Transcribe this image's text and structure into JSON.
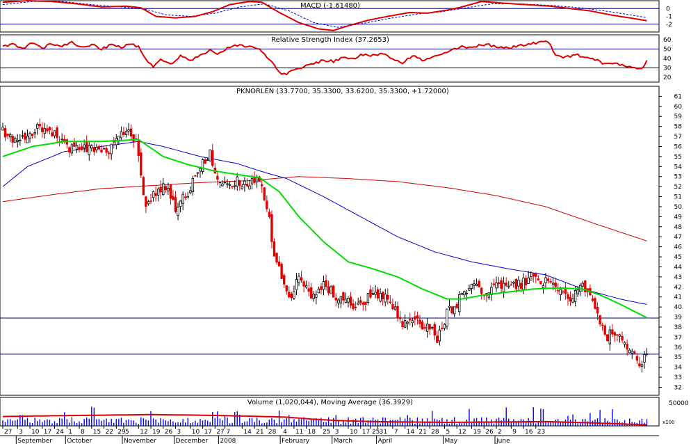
{
  "chart_data": {
    "type": "candlestick",
    "price_panel": {
      "label": "PKNORLEN (33.7700, 35.3300, 33.6200, 35.3300, +1.72000)",
      "ylim": [
        31.2,
        62.0
      ],
      "ticks": [
        32,
        33,
        34,
        35,
        36,
        37,
        38,
        39,
        40,
        41,
        42,
        43,
        44,
        45,
        46,
        47,
        48,
        49,
        50,
        51,
        52,
        53,
        54,
        55,
        56,
        57,
        58,
        59,
        60,
        61
      ],
      "hlines": [
        38.9,
        35.3
      ],
      "close_anchors": [
        [
          0,
          57.5
        ],
        [
          5,
          56.5
        ],
        [
          10,
          57.0
        ],
        [
          15,
          58.0
        ],
        [
          20,
          57.5
        ],
        [
          25,
          56.0
        ],
        [
          30,
          55.8
        ],
        [
          35,
          56.0
        ],
        [
          40,
          55.2
        ],
        [
          45,
          56.0
        ],
        [
          50,
          57.8
        ],
        [
          54,
          56.5
        ],
        [
          58,
          50.0
        ],
        [
          62,
          51.5
        ],
        [
          66,
          52.0
        ],
        [
          70,
          50.0
        ],
        [
          75,
          51.5
        ],
        [
          80,
          54.0
        ],
        [
          84,
          55.5
        ],
        [
          86,
          53.5
        ],
        [
          90,
          52.0
        ],
        [
          95,
          52.6
        ],
        [
          100,
          52.4
        ],
        [
          104,
          52.5
        ],
        [
          108,
          49.0
        ],
        [
          110,
          45.0
        ],
        [
          113,
          43.0
        ],
        [
          117,
          41.0
        ],
        [
          120,
          43.0
        ],
        [
          125,
          41.0
        ],
        [
          130,
          42.5
        ],
        [
          135,
          41.0
        ],
        [
          140,
          40.5
        ],
        [
          145,
          40.0
        ],
        [
          150,
          41.5
        ],
        [
          155,
          41.0
        ],
        [
          158,
          40.0
        ],
        [
          162,
          38.5
        ],
        [
          166,
          39.0
        ],
        [
          170,
          38.2
        ],
        [
          174,
          37.5
        ],
        [
          176,
          36.5
        ],
        [
          180,
          39.5
        ],
        [
          184,
          40.0
        ],
        [
          186,
          41.5
        ],
        [
          190,
          42.0
        ],
        [
          195,
          41.5
        ],
        [
          200,
          42.0
        ],
        [
          205,
          42.0
        ],
        [
          210,
          42.3
        ],
        [
          215,
          43.0
        ],
        [
          220,
          42.5
        ],
        [
          225,
          41.5
        ],
        [
          230,
          41.0
        ],
        [
          235,
          42.0
        ],
        [
          238,
          41.0
        ],
        [
          242,
          38.5
        ],
        [
          244,
          37.0
        ],
        [
          248,
          37.5
        ],
        [
          252,
          36.0
        ],
        [
          256,
          35.0
        ],
        [
          258,
          34.0
        ],
        [
          261,
          35.33
        ]
      ],
      "ma_green": [
        [
          0,
          55.0
        ],
        [
          12,
          56.0
        ],
        [
          25,
          56.5
        ],
        [
          40,
          56.5
        ],
        [
          55,
          56.7
        ],
        [
          65,
          55.0
        ],
        [
          75,
          54.2
        ],
        [
          85,
          53.6
        ],
        [
          95,
          53.2
        ],
        [
          104,
          52.9
        ],
        [
          112,
          51.5
        ],
        [
          120,
          49.0
        ],
        [
          130,
          46.5
        ],
        [
          140,
          44.5
        ],
        [
          150,
          43.8
        ],
        [
          160,
          43.0
        ],
        [
          170,
          41.8
        ],
        [
          180,
          40.8
        ],
        [
          186,
          40.8
        ],
        [
          195,
          41.2
        ],
        [
          205,
          41.5
        ],
        [
          215,
          41.8
        ],
        [
          225,
          41.9
        ],
        [
          235,
          41.8
        ],
        [
          242,
          41.2
        ],
        [
          250,
          40.3
        ],
        [
          258,
          39.3
        ],
        [
          262,
          38.8
        ]
      ],
      "ma_blue": [
        [
          0,
          52.0
        ],
        [
          10,
          54.0
        ],
        [
          25,
          55.5
        ],
        [
          40,
          56.0
        ],
        [
          55,
          56.5
        ],
        [
          65,
          56.0
        ],
        [
          80,
          55.0
        ],
        [
          95,
          54.3
        ],
        [
          105,
          53.5
        ],
        [
          115,
          52.8
        ],
        [
          130,
          51.0
        ],
        [
          145,
          49.0
        ],
        [
          160,
          47.0
        ],
        [
          175,
          45.5
        ],
        [
          190,
          44.5
        ],
        [
          205,
          43.8
        ],
        [
          220,
          43.2
        ],
        [
          235,
          41.8
        ],
        [
          250,
          40.8
        ],
        [
          262,
          40.2
        ]
      ],
      "ma_red": [
        [
          0,
          50.5
        ],
        [
          20,
          51.2
        ],
        [
          40,
          51.8
        ],
        [
          60,
          52.1
        ],
        [
          80,
          52.4
        ],
        [
          100,
          52.6
        ],
        [
          120,
          53.0
        ],
        [
          140,
          52.8
        ],
        [
          160,
          52.5
        ],
        [
          180,
          51.9
        ],
        [
          200,
          51.1
        ],
        [
          220,
          50.0
        ],
        [
          240,
          48.3
        ],
        [
          262,
          46.5
        ]
      ]
    },
    "macd_panel": {
      "label": "MACD (-1.61480)",
      "ylim": [
        -3,
        1
      ],
      "ticks": [
        0,
        -1,
        -2
      ],
      "hlines": [
        0,
        -2
      ],
      "macd_anchors": [
        [
          0,
          0.8
        ],
        [
          10,
          1.0
        ],
        [
          20,
          0.9
        ],
        [
          30,
          0.6
        ],
        [
          40,
          0.2
        ],
        [
          50,
          0.3
        ],
        [
          56,
          0.1
        ],
        [
          62,
          -1.0
        ],
        [
          70,
          -1.2
        ],
        [
          78,
          -1.0
        ],
        [
          85,
          -0.4
        ],
        [
          92,
          0.5
        ],
        [
          100,
          0.9
        ],
        [
          105,
          0.8
        ],
        [
          112,
          -0.5
        ],
        [
          120,
          -1.8
        ],
        [
          128,
          -2.6
        ],
        [
          134,
          -2.8
        ],
        [
          140,
          -2.2
        ],
        [
          148,
          -1.5
        ],
        [
          156,
          -1.0
        ],
        [
          165,
          -0.5
        ],
        [
          172,
          -0.6
        ],
        [
          180,
          -0.2
        ],
        [
          186,
          0.2
        ],
        [
          194,
          0.9
        ],
        [
          202,
          0.7
        ],
        [
          212,
          0.5
        ],
        [
          222,
          0.3
        ],
        [
          230,
          0.0
        ],
        [
          238,
          -0.3
        ],
        [
          246,
          -0.8
        ],
        [
          254,
          -1.2
        ],
        [
          262,
          -1.6
        ]
      ],
      "signal_anchors": [
        [
          0,
          0.5
        ],
        [
          12,
          0.9
        ],
        [
          24,
          0.9
        ],
        [
          36,
          0.5
        ],
        [
          48,
          0.2
        ],
        [
          58,
          -0.1
        ],
        [
          66,
          -0.8
        ],
        [
          76,
          -1.0
        ],
        [
          86,
          -0.6
        ],
        [
          96,
          0.2
        ],
        [
          106,
          0.6
        ],
        [
          116,
          -0.3
        ],
        [
          126,
          -1.8
        ],
        [
          136,
          -2.4
        ],
        [
          146,
          -1.9
        ],
        [
          156,
          -1.3
        ],
        [
          168,
          -0.7
        ],
        [
          178,
          -0.4
        ],
        [
          188,
          0.1
        ],
        [
          198,
          0.6
        ],
        [
          210,
          0.6
        ],
        [
          222,
          0.4
        ],
        [
          234,
          0.1
        ],
        [
          246,
          -0.4
        ],
        [
          262,
          -1.2
        ]
      ]
    },
    "rsi_panel": {
      "label": "Relative Strength Index (37.2653)",
      "ylim": [
        15,
        65
      ],
      "ticks": [
        60,
        50,
        40,
        30,
        20
      ],
      "hlines": [
        50,
        30
      ],
      "anchors": [
        [
          0,
          52
        ],
        [
          4,
          55
        ],
        [
          8,
          50
        ],
        [
          12,
          57
        ],
        [
          16,
          51
        ],
        [
          20,
          56
        ],
        [
          24,
          53
        ],
        [
          28,
          57
        ],
        [
          32,
          52
        ],
        [
          36,
          55
        ],
        [
          40,
          49
        ],
        [
          44,
          56
        ],
        [
          48,
          52
        ],
        [
          52,
          55
        ],
        [
          55,
          53
        ],
        [
          58,
          40
        ],
        [
          61,
          30
        ],
        [
          64,
          40
        ],
        [
          68,
          34
        ],
        [
          72,
          43
        ],
        [
          76,
          37
        ],
        [
          80,
          45
        ],
        [
          84,
          48
        ],
        [
          88,
          45
        ],
        [
          92,
          53
        ],
        [
          96,
          55
        ],
        [
          100,
          52
        ],
        [
          104,
          50
        ],
        [
          108,
          40
        ],
        [
          111,
          28
        ],
        [
          114,
          23
        ],
        [
          118,
          27
        ],
        [
          122,
          31
        ],
        [
          126,
          35
        ],
        [
          130,
          38
        ],
        [
          134,
          37
        ],
        [
          138,
          41
        ],
        [
          142,
          40
        ],
        [
          146,
          44
        ],
        [
          150,
          43
        ],
        [
          154,
          46
        ],
        [
          158,
          40
        ],
        [
          162,
          36
        ],
        [
          166,
          43
        ],
        [
          170,
          38
        ],
        [
          174,
          41
        ],
        [
          178,
          44
        ],
        [
          182,
          49
        ],
        [
          186,
          52
        ],
        [
          190,
          51
        ],
        [
          195,
          55
        ],
        [
          200,
          53
        ],
        [
          205,
          51
        ],
        [
          210,
          54
        ],
        [
          215,
          56
        ],
        [
          218,
          58
        ],
        [
          221,
          57
        ],
        [
          224,
          45
        ],
        [
          228,
          41
        ],
        [
          232,
          44
        ],
        [
          236,
          42
        ],
        [
          240,
          39
        ],
        [
          244,
          34
        ],
        [
          248,
          35
        ],
        [
          252,
          33
        ],
        [
          256,
          31
        ],
        [
          259,
          29
        ],
        [
          261,
          37
        ]
      ]
    },
    "volume_panel": {
      "label": "Volume (1,020,044), Moving Average (36.3929)",
      "tick_labels": [
        "50000",
        "x100"
      ],
      "ma_anchors": [
        [
          0,
          0.48
        ],
        [
          20,
          0.52
        ],
        [
          40,
          0.55
        ],
        [
          60,
          0.58
        ],
        [
          80,
          0.55
        ],
        [
          100,
          0.5
        ],
        [
          115,
          0.45
        ],
        [
          125,
          0.35
        ],
        [
          135,
          0.28
        ],
        [
          150,
          0.22
        ],
        [
          165,
          0.2
        ],
        [
          180,
          0.18
        ],
        [
          200,
          0.2
        ],
        [
          220,
          0.22
        ],
        [
          240,
          0.15
        ],
        [
          262,
          0.05
        ]
      ]
    },
    "x_axis": {
      "day_labels": [
        {
          "i": 0,
          "t": "27"
        },
        {
          "i": 6,
          "t": "3"
        },
        {
          "i": 11,
          "t": "10"
        },
        {
          "i": 16,
          "t": "17"
        },
        {
          "i": 21,
          "t": "24"
        },
        {
          "i": 26,
          "t": "1"
        },
        {
          "i": 31,
          "t": "8"
        },
        {
          "i": 36,
          "t": "15"
        },
        {
          "i": 41,
          "t": "22"
        },
        {
          "i": 46,
          "t": "29"
        },
        {
          "i": 49,
          "t": "5"
        },
        {
          "i": 55,
          "t": "12"
        },
        {
          "i": 60,
          "t": "19"
        },
        {
          "i": 65,
          "t": "26"
        },
        {
          "i": 70,
          "t": "3"
        },
        {
          "i": 76,
          "t": "10"
        },
        {
          "i": 81,
          "t": "17"
        },
        {
          "i": 86,
          "t": "27"
        },
        {
          "i": 90,
          "t": "7"
        },
        {
          "i": 97,
          "t": "14"
        },
        {
          "i": 102,
          "t": "21"
        },
        {
          "i": 107,
          "t": "28"
        },
        {
          "i": 113,
          "t": "4"
        },
        {
          "i": 118,
          "t": "11"
        },
        {
          "i": 123,
          "t": "18"
        },
        {
          "i": 129,
          "t": "25"
        },
        {
          "i": 134,
          "t": "3"
        },
        {
          "i": 140,
          "t": "10"
        },
        {
          "i": 145,
          "t": "17"
        },
        {
          "i": 149,
          "t": "25"
        },
        {
          "i": 152,
          "t": "31"
        },
        {
          "i": 158,
          "t": "7"
        },
        {
          "i": 163,
          "t": "14"
        },
        {
          "i": 168,
          "t": "21"
        },
        {
          "i": 173,
          "t": "28"
        },
        {
          "i": 179,
          "t": "5"
        },
        {
          "i": 184,
          "t": "12"
        },
        {
          "i": 190,
          "t": "19"
        },
        {
          "i": 195,
          "t": "26"
        },
        {
          "i": 200,
          "t": "2"
        },
        {
          "i": 206,
          "t": "9"
        },
        {
          "i": 211,
          "t": "16"
        },
        {
          "i": 216,
          "t": "23"
        }
      ],
      "month_labels": [
        {
          "i": 6,
          "t": "September"
        },
        {
          "i": 26,
          "t": "October"
        },
        {
          "i": 49,
          "t": "November"
        },
        {
          "i": 70,
          "t": "December"
        },
        {
          "i": 88,
          "t": "2008"
        },
        {
          "i": 113,
          "t": "February"
        },
        {
          "i": 134,
          "t": "March"
        },
        {
          "i": 152,
          "t": "April"
        },
        {
          "i": 179,
          "t": "May"
        },
        {
          "i": 200,
          "t": "June"
        }
      ]
    },
    "colors": {
      "up": "#000000",
      "down": "#e00000",
      "ma_fast": "#00dd00",
      "ma_mid": "#0000cc",
      "ma_slow": "#cc0000",
      "volume": "#0000ff",
      "grid": "#000080"
    }
  }
}
